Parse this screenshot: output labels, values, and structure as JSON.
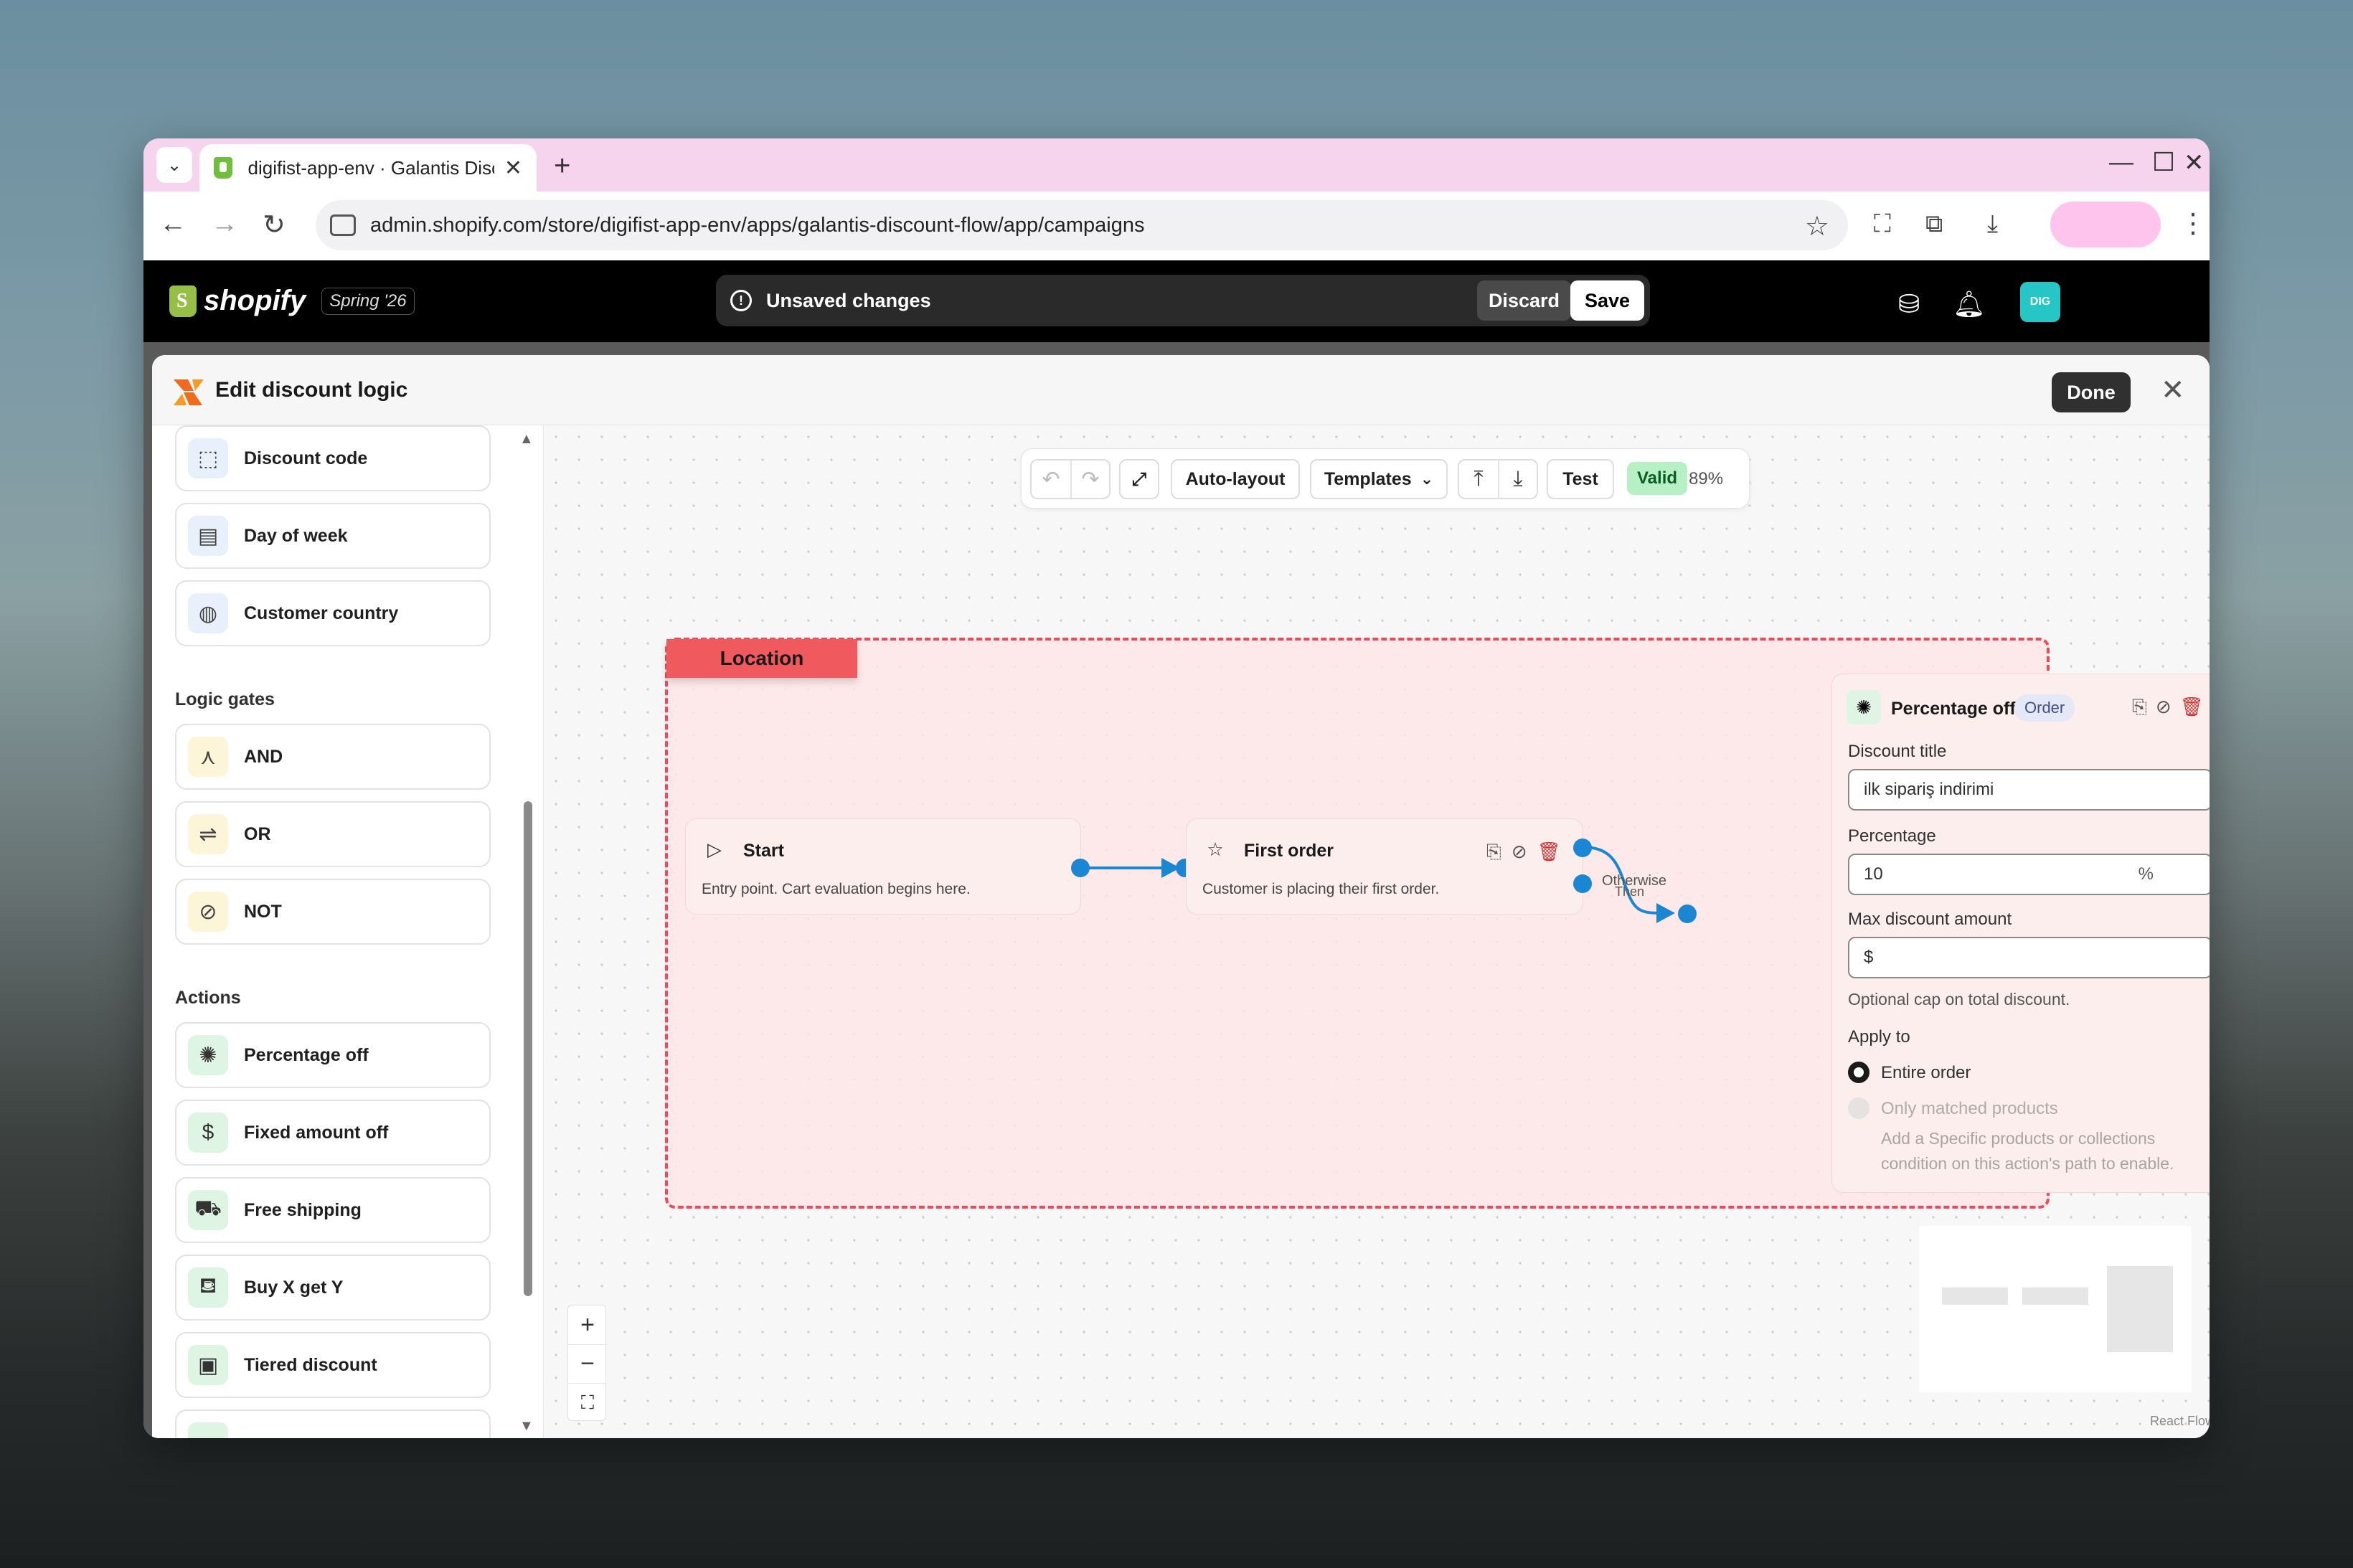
{
  "browser": {
    "tab_title": "digifist-app-env · Galantis Disco",
    "url": "admin.shopify.com/store/digifist-app-env/apps/galantis-discount-flow/app/campaigns"
  },
  "shopify": {
    "brand": "shopify",
    "version": "Spring '26",
    "unsaved_text": "Unsaved changes",
    "discard_label": "Discard",
    "save_label": "Save",
    "avatar_text": "DIG"
  },
  "modal": {
    "title": "Edit discount logic",
    "done_label": "Done"
  },
  "sidebar": {
    "conditions": [
      {
        "label": "Discount code",
        "icon": "qr-dashed-icon"
      },
      {
        "label": "Day of week",
        "icon": "calendar-icon"
      },
      {
        "label": "Customer country",
        "icon": "globe-icon"
      }
    ],
    "logic_heading": "Logic gates",
    "logic": [
      {
        "label": "AND",
        "icon": "and-icon"
      },
      {
        "label": "OR",
        "icon": "or-icon"
      },
      {
        "label": "NOT",
        "icon": "not-icon"
      }
    ],
    "actions_heading": "Actions",
    "actions": [
      {
        "label": "Percentage off",
        "icon": "percent-badge-icon"
      },
      {
        "label": "Fixed amount off",
        "icon": "dollar-icon"
      },
      {
        "label": "Free shipping",
        "icon": "truck-icon"
      },
      {
        "label": "Buy X get Y",
        "icon": "cart-icon"
      },
      {
        "label": "Tiered discount",
        "icon": "layers-icon"
      }
    ]
  },
  "toolbar": {
    "auto_layout": "Auto-layout",
    "templates": "Templates",
    "test": "Test",
    "valid": "Valid",
    "zoom": "89%"
  },
  "canvas": {
    "group_label": "Location",
    "start_node": {
      "title": "Start",
      "desc": "Entry point. Cart evaluation begins here."
    },
    "first_order_node": {
      "title": "First order",
      "desc": "Customer is placing their first order."
    },
    "edge_otherwise": "Otherwise",
    "edge_then": "Then",
    "attribution": "React Flow"
  },
  "action_panel": {
    "title": "Percentage off",
    "badge": "Order",
    "discount_title_label": "Discount title",
    "discount_title_value": "ilk sipariş indirimi",
    "percentage_label": "Percentage",
    "percentage_value": "10",
    "percentage_suffix": "%",
    "max_label": "Max discount amount",
    "max_prefix": "$",
    "max_help": "Optional cap on total discount.",
    "apply_label": "Apply to",
    "opt_entire": "Entire order",
    "opt_matched": "Only matched products",
    "matched_help": "Add a Specific products or collections condition on this action's path to enable."
  },
  "colors": {
    "accent_handle": "#1a86d4",
    "group_border": "#ee4a5c",
    "group_tag": "#f0595e",
    "valid_bg": "#b6f0c4",
    "tab_strip": "#f7d4ee"
  }
}
